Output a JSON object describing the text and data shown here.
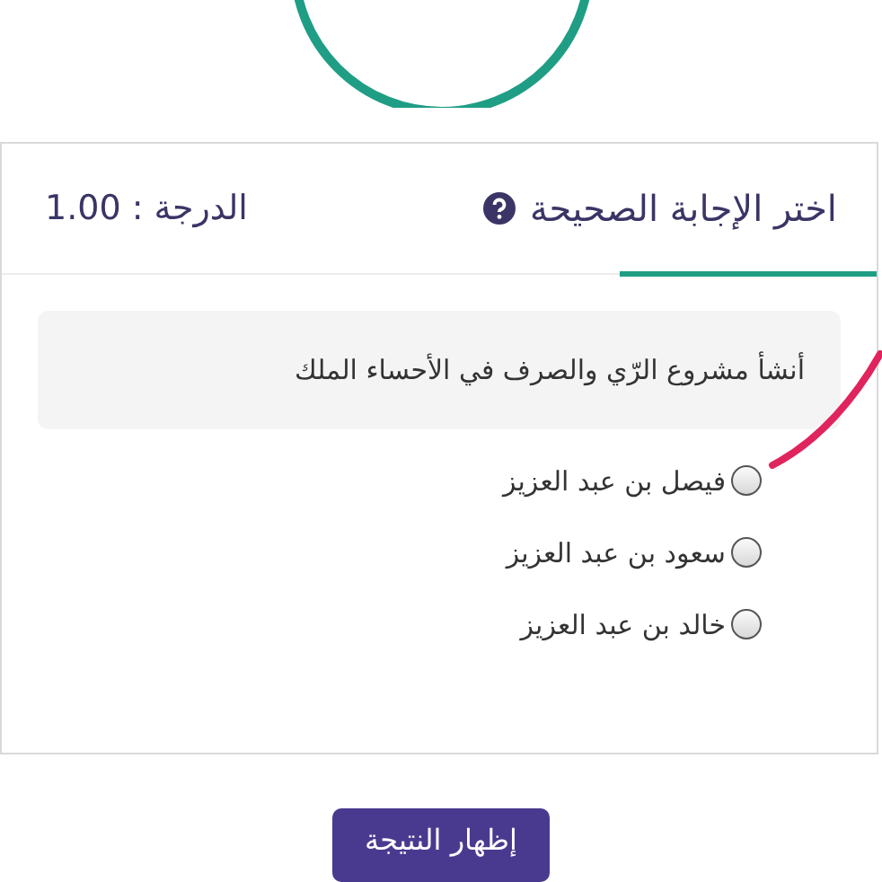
{
  "question_card": {
    "title": "اختر الإجابة الصحيحة",
    "score": "الدرجة : 1.00",
    "question": "أنشأ مشروع الرّي والصرف في الأحساء الملك",
    "options": [
      {
        "label": "فيصل بن عبد العزيز",
        "selected": false
      },
      {
        "label": "سعود بن عبد العزيز",
        "selected": false
      },
      {
        "label": "خالد بن عبد العزيز",
        "selected": false
      }
    ]
  },
  "result_button": "إظهار النتيجة"
}
